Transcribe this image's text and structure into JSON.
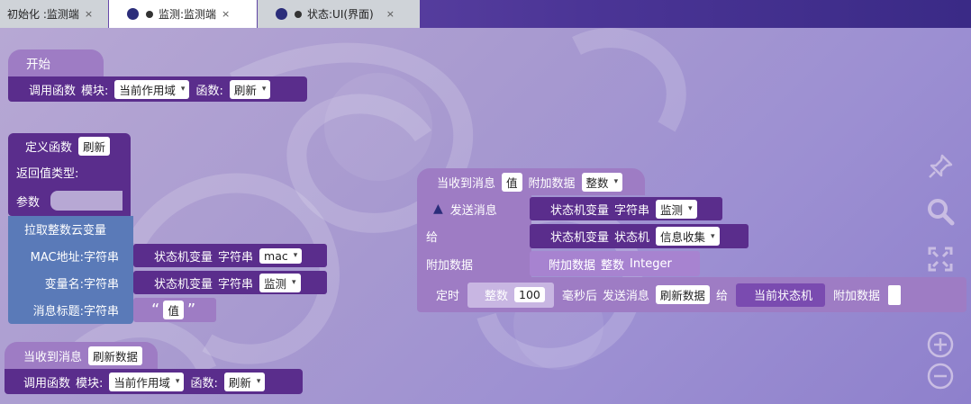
{
  "tabs": [
    {
      "label": "初始化 :监测端",
      "close": "×"
    },
    {
      "label": "监测:监测端",
      "close": "×"
    },
    {
      "label": "状态:UI(界面)",
      "close": "×"
    }
  ],
  "block_start": {
    "hat": "开始",
    "call_label": "调用函数",
    "module_label": "模块:",
    "module_value": "当前作用域",
    "func_label": "函数:",
    "func_value": "刷新"
  },
  "block_define": {
    "label": "定义函数",
    "name": "刷新",
    "return_label": "返回值类型:",
    "params_label": "参数"
  },
  "block_pull": {
    "label": "拉取整数云变量",
    "mac_label": "MAC地址:字符串",
    "mac_sm_label": "状态机变量",
    "mac_str_label": "字符串",
    "mac_value": "mac",
    "var_label": "变量名:字符串",
    "var_sm_label": "状态机变量",
    "var_str_label": "字符串",
    "var_value": "监测",
    "title_label": "消息标题:字符串",
    "quote_open": "“",
    "title_value": "值",
    "quote_close": "”"
  },
  "block_recv_refresh": {
    "label": "当收到消息",
    "msg": "刷新数据",
    "call_label": "调用函数",
    "module_label": "模块:",
    "module_value": "当前作用域",
    "func_label": "函数:",
    "func_value": "刷新"
  },
  "block_recv_value": {
    "label": "当收到消息",
    "msg": "值",
    "extra_label": "附加数据",
    "extra_type": "整数",
    "send_label": "发送消息",
    "send_sm_label": "状态机变量",
    "send_str_label": "字符串",
    "send_value": "监测",
    "to_label": "给",
    "to_sm_label": "状态机变量",
    "to_machine_label": "状态机",
    "to_value": "信息收集",
    "attach_label": "附加数据",
    "attach_block_label": "附加数据",
    "attach_type": "整数",
    "attach_kind": "Integer",
    "timer_label": "定时",
    "timer_int_label": "整数",
    "timer_value": "100",
    "ms_label": "毫秒后",
    "timer_send_label": "发送消息",
    "timer_msg": "刷新数据",
    "timer_to_label": "给",
    "current_sm": "当前状态机",
    "timer_attach_label": "附加数据"
  },
  "colors": {
    "purple": "#6b3fa0",
    "dark": "#5a2d8c",
    "lavender": "#9e7cc4",
    "blue": "#5a7ab8"
  }
}
